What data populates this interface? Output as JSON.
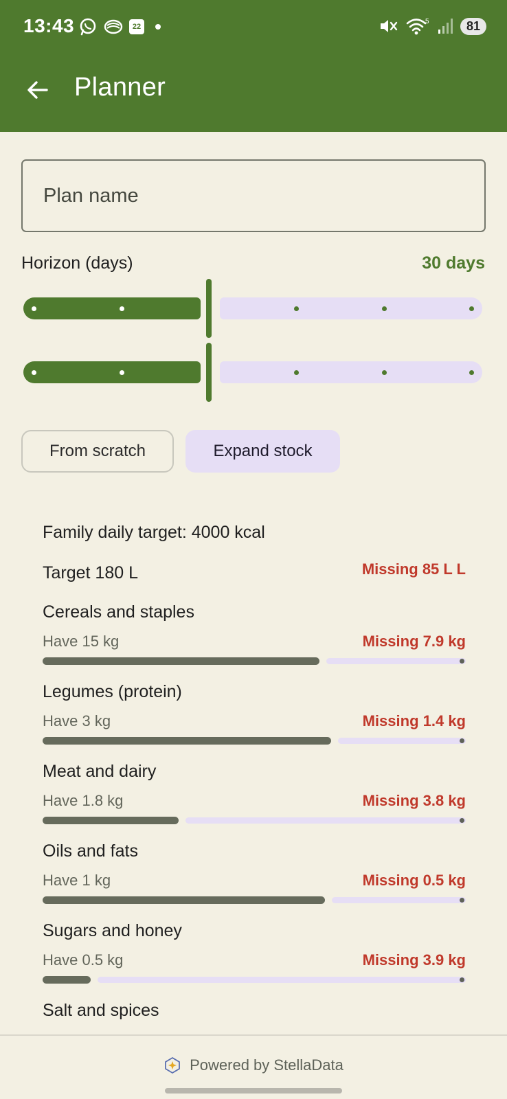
{
  "status_bar": {
    "time": "13:43",
    "calendar_day": "22",
    "signal_label": "5",
    "battery": "81"
  },
  "app_bar": {
    "title": "Planner"
  },
  "plan_name": {
    "placeholder": "Plan name",
    "value": ""
  },
  "horizon": {
    "label": "Horizon (days)",
    "value_text": "30 days"
  },
  "modes": {
    "from_scratch": "From scratch",
    "expand_stock": "Expand stock"
  },
  "summary": {
    "family_target": "Family daily target: 4000 kcal",
    "water_target": "Target 180 L",
    "water_missing": "Missing 85 L L"
  },
  "categories": [
    {
      "name": "Cereals and staples",
      "have": "Have 15 kg",
      "missing": "Missing 7.9 kg",
      "progress": 0.655
    },
    {
      "name": "Legumes (protein)",
      "have": "Have 3 kg",
      "missing": "Missing 1.4 kg",
      "progress": 0.682
    },
    {
      "name": "Meat and dairy",
      "have": "Have 1.8 kg",
      "missing": "Missing 3.8 kg",
      "progress": 0.321
    },
    {
      "name": "Oils and fats",
      "have": "Have 1 kg",
      "missing": "Missing 0.5 kg",
      "progress": 0.667
    },
    {
      "name": "Sugars and honey",
      "have": "Have 0.5 kg",
      "missing": "Missing 3.9 kg",
      "progress": 0.114
    },
    {
      "name": "Salt and spices"
    }
  ],
  "footer": {
    "powered_by": "Powered by StellaData"
  },
  "colors": {
    "primary": "#4F7A2E",
    "background": "#F3F0E3",
    "missing_red": "#C0392B",
    "track_lavender": "#E6DEF5"
  }
}
